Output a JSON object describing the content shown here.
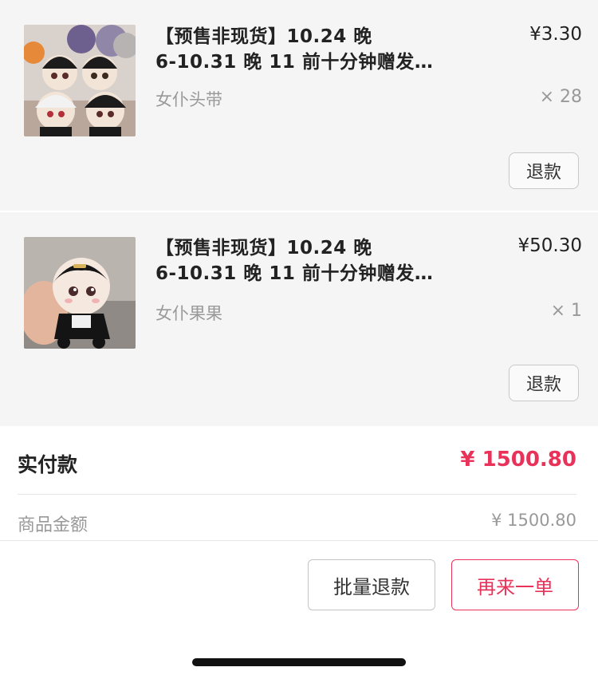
{
  "items": [
    {
      "title_line1": "【预售非现货】10.24 晚",
      "title_line2": "6-10.31 晚 11 前十分钟赠发…",
      "price": "¥3.30",
      "variant": "女仆头带",
      "quantity": "× 28",
      "refund_label": "退款",
      "thumbnail_icon": "plush-dolls-photo"
    },
    {
      "title_line1": "【预售非现货】10.24 晚",
      "title_line2": "6-10.31 晚 11 前十分钟赠发…",
      "price": "¥50.30",
      "variant": "女仆果果",
      "quantity": "× 1",
      "refund_label": "退款",
      "thumbnail_icon": "plush-doll-in-hand-photo"
    }
  ],
  "summary": {
    "paid_label": "实付款",
    "paid_amount": "¥ 1500.80",
    "goods_label": "商品金额",
    "goods_amount": "¥ 1500.80"
  },
  "footer": {
    "batch_refund_label": "批量退款",
    "reorder_label": "再来一单"
  },
  "colors": {
    "accent": "#e8325a",
    "item_background": "#f5f5f5",
    "muted_text": "#999999"
  }
}
